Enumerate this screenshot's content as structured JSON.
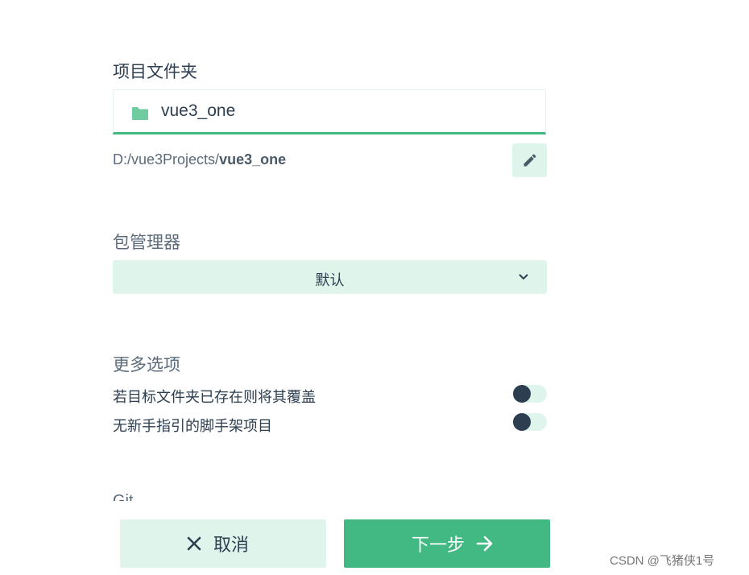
{
  "project_folder": {
    "title": "项目文件夹",
    "folder_name": "vue3_one",
    "path_prefix": "D:/vue3Projects/",
    "path_name": "vue3_one",
    "folder_icon": "folder-icon",
    "edit_icon": "pencil-icon"
  },
  "package_manager": {
    "title": "包管理器",
    "selected": "默认",
    "chevron_icon": "chevron-down-icon"
  },
  "more_options": {
    "title": "更多选项",
    "items": [
      {
        "label": "若目标文件夹已存在则将其覆盖",
        "enabled": false
      },
      {
        "label": "无新手指引的脚手架项目",
        "enabled": false
      }
    ]
  },
  "git": {
    "title": "Git"
  },
  "actions": {
    "cancel_label": "取消",
    "cancel_icon": "close-icon",
    "next_label": "下一步",
    "next_icon": "arrow-right-icon"
  },
  "watermark": "CSDN @飞猪侠1号",
  "colors": {
    "accent": "#42b983",
    "accent_light": "#dff5ec",
    "text": "#2c3e50"
  }
}
